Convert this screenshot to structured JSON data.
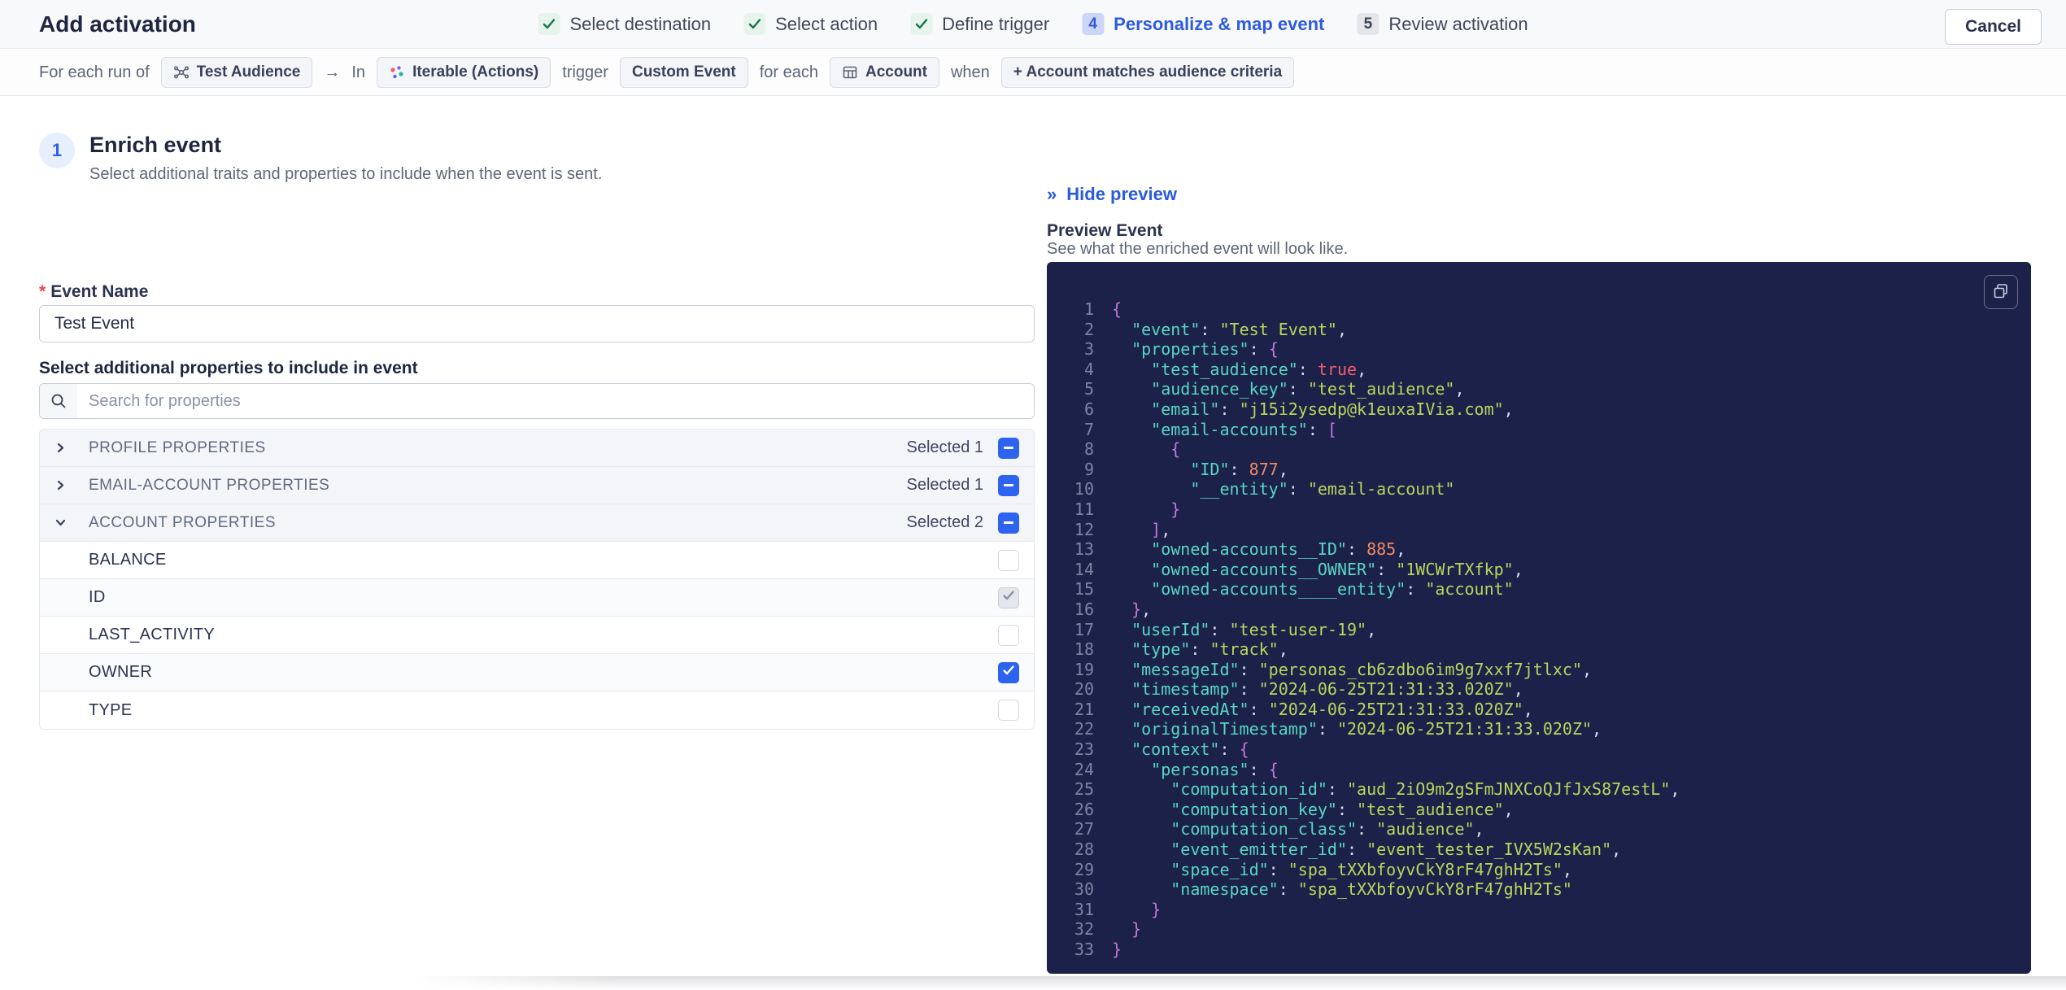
{
  "header": {
    "title": "Add activation",
    "cancel_label": "Cancel",
    "steps": [
      {
        "label": "Select destination",
        "state": "done"
      },
      {
        "label": "Select action",
        "state": "done"
      },
      {
        "label": "Define trigger",
        "state": "done"
      },
      {
        "label": "Personalize & map event",
        "state": "active",
        "number": "4"
      },
      {
        "label": "Review activation",
        "state": "upcoming",
        "number": "5"
      }
    ]
  },
  "trigger_bar": {
    "prefix": "For each run of",
    "audience_chip": "Test Audience",
    "arrow": "→",
    "in_label": "In",
    "destination_chip": "Iterable (Actions)",
    "trigger_label": "trigger",
    "event_chip": "Custom Event",
    "for_each_label": "for each",
    "entity_chip": "Account",
    "when_label": "when",
    "criteria_chip": "+ Account matches audience criteria"
  },
  "enrich": {
    "step_number": "1",
    "title": "Enrich event",
    "subtitle": "Select additional traits and properties to include when the event is sent.",
    "event_name_label": "Event Name",
    "required_marker": "*",
    "event_name_value": "Test Event",
    "properties_label": "Select additional properties to include in event",
    "search_placeholder": "Search for properties",
    "sections": [
      {
        "label": "PROFILE PROPERTIES",
        "selected_text": "Selected 1",
        "expanded": false,
        "items": []
      },
      {
        "label": "EMAIL-ACCOUNT PROPERTIES",
        "selected_text": "Selected 1",
        "expanded": false,
        "items": []
      },
      {
        "label": "ACCOUNT PROPERTIES",
        "selected_text": "Selected 2",
        "expanded": true,
        "items": [
          {
            "label": "BALANCE",
            "checked": false,
            "disabled": false
          },
          {
            "label": "ID",
            "checked": true,
            "disabled": true
          },
          {
            "label": "LAST_ACTIVITY",
            "checked": false,
            "disabled": false
          },
          {
            "label": "OWNER",
            "checked": true,
            "disabled": false
          },
          {
            "label": "TYPE",
            "checked": false,
            "disabled": false
          }
        ]
      }
    ]
  },
  "preview": {
    "hide_glyph": "»",
    "hide_label": "Hide preview",
    "title": "Preview Event",
    "subtitle": "See what the enriched event will look like.",
    "code_lines": [
      {
        "n": "1",
        "tokens": [
          [
            "p",
            "{"
          ]
        ]
      },
      {
        "n": "2",
        "tokens": [
          [
            "d",
            "  "
          ],
          [
            "k",
            "\"event\""
          ],
          [
            "d",
            ": "
          ],
          [
            "s",
            "\"Test Event\""
          ],
          [
            "d",
            ","
          ]
        ]
      },
      {
        "n": "3",
        "tokens": [
          [
            "d",
            "  "
          ],
          [
            "k",
            "\"properties\""
          ],
          [
            "d",
            ": "
          ],
          [
            "p",
            "{"
          ]
        ]
      },
      {
        "n": "4",
        "tokens": [
          [
            "d",
            "    "
          ],
          [
            "k",
            "\"test_audience\""
          ],
          [
            "d",
            ": "
          ],
          [
            "b",
            "true"
          ],
          [
            "d",
            ","
          ]
        ]
      },
      {
        "n": "5",
        "tokens": [
          [
            "d",
            "    "
          ],
          [
            "k",
            "\"audience_key\""
          ],
          [
            "d",
            ": "
          ],
          [
            "s",
            "\"test_audience\""
          ],
          [
            "d",
            ","
          ]
        ]
      },
      {
        "n": "6",
        "tokens": [
          [
            "d",
            "    "
          ],
          [
            "k",
            "\"email\""
          ],
          [
            "d",
            ": "
          ],
          [
            "s",
            "\"j15i2ysedp@k1euxaIVia.com\""
          ],
          [
            "d",
            ","
          ]
        ]
      },
      {
        "n": "7",
        "tokens": [
          [
            "d",
            "    "
          ],
          [
            "k",
            "\"email-accounts\""
          ],
          [
            "d",
            ": "
          ],
          [
            "p",
            "["
          ]
        ]
      },
      {
        "n": "8",
        "tokens": [
          [
            "d",
            "      "
          ],
          [
            "p",
            "{"
          ]
        ]
      },
      {
        "n": "9",
        "tokens": [
          [
            "d",
            "        "
          ],
          [
            "k",
            "\"ID\""
          ],
          [
            "d",
            ": "
          ],
          [
            "n",
            "877"
          ],
          [
            "d",
            ","
          ]
        ]
      },
      {
        "n": "10",
        "tokens": [
          [
            "d",
            "        "
          ],
          [
            "k",
            "\"__entity\""
          ],
          [
            "d",
            ": "
          ],
          [
            "s",
            "\"email-account\""
          ]
        ]
      },
      {
        "n": "11",
        "tokens": [
          [
            "d",
            "      "
          ],
          [
            "p",
            "}"
          ]
        ]
      },
      {
        "n": "12",
        "tokens": [
          [
            "d",
            "    "
          ],
          [
            "p",
            "]"
          ],
          [
            "d",
            ","
          ]
        ]
      },
      {
        "n": "13",
        "tokens": [
          [
            "d",
            "    "
          ],
          [
            "k",
            "\"owned-accounts__ID\""
          ],
          [
            "d",
            ": "
          ],
          [
            "n",
            "885"
          ],
          [
            "d",
            ","
          ]
        ]
      },
      {
        "n": "14",
        "tokens": [
          [
            "d",
            "    "
          ],
          [
            "k",
            "\"owned-accounts__OWNER\""
          ],
          [
            "d",
            ": "
          ],
          [
            "s",
            "\"1WCWrTXfkp\""
          ],
          [
            "d",
            ","
          ]
        ]
      },
      {
        "n": "15",
        "tokens": [
          [
            "d",
            "    "
          ],
          [
            "k",
            "\"owned-accounts____entity\""
          ],
          [
            "d",
            ": "
          ],
          [
            "s",
            "\"account\""
          ]
        ]
      },
      {
        "n": "16",
        "tokens": [
          [
            "d",
            "  "
          ],
          [
            "p",
            "}"
          ],
          [
            "d",
            ","
          ]
        ]
      },
      {
        "n": "17",
        "tokens": [
          [
            "d",
            "  "
          ],
          [
            "k",
            "\"userId\""
          ],
          [
            "d",
            ": "
          ],
          [
            "s",
            "\"test-user-19\""
          ],
          [
            "d",
            ","
          ]
        ]
      },
      {
        "n": "18",
        "tokens": [
          [
            "d",
            "  "
          ],
          [
            "k",
            "\"type\""
          ],
          [
            "d",
            ": "
          ],
          [
            "s",
            "\"track\""
          ],
          [
            "d",
            ","
          ]
        ]
      },
      {
        "n": "19",
        "tokens": [
          [
            "d",
            "  "
          ],
          [
            "k",
            "\"messageId\""
          ],
          [
            "d",
            ": "
          ],
          [
            "s",
            "\"personas_cb6zdbo6im9g7xxf7jtlxc\""
          ],
          [
            "d",
            ","
          ]
        ]
      },
      {
        "n": "20",
        "tokens": [
          [
            "d",
            "  "
          ],
          [
            "k",
            "\"timestamp\""
          ],
          [
            "d",
            ": "
          ],
          [
            "s",
            "\"2024-06-25T21:31:33.020Z\""
          ],
          [
            "d",
            ","
          ]
        ]
      },
      {
        "n": "21",
        "tokens": [
          [
            "d",
            "  "
          ],
          [
            "k",
            "\"receivedAt\""
          ],
          [
            "d",
            ": "
          ],
          [
            "s",
            "\"2024-06-25T21:31:33.020Z\""
          ],
          [
            "d",
            ","
          ]
        ]
      },
      {
        "n": "22",
        "tokens": [
          [
            "d",
            "  "
          ],
          [
            "k",
            "\"originalTimestamp\""
          ],
          [
            "d",
            ": "
          ],
          [
            "s",
            "\"2024-06-25T21:31:33.020Z\""
          ],
          [
            "d",
            ","
          ]
        ]
      },
      {
        "n": "23",
        "tokens": [
          [
            "d",
            "  "
          ],
          [
            "k",
            "\"context\""
          ],
          [
            "d",
            ": "
          ],
          [
            "p",
            "{"
          ]
        ]
      },
      {
        "n": "24",
        "tokens": [
          [
            "d",
            "    "
          ],
          [
            "k",
            "\"personas\""
          ],
          [
            "d",
            ": "
          ],
          [
            "p",
            "{"
          ]
        ]
      },
      {
        "n": "25",
        "tokens": [
          [
            "d",
            "      "
          ],
          [
            "k",
            "\"computation_id\""
          ],
          [
            "d",
            ": "
          ],
          [
            "s",
            "\"aud_2iO9m2gSFmJNXCoQJfJxS87estL\""
          ],
          [
            "d",
            ","
          ]
        ]
      },
      {
        "n": "26",
        "tokens": [
          [
            "d",
            "      "
          ],
          [
            "k",
            "\"computation_key\""
          ],
          [
            "d",
            ": "
          ],
          [
            "s",
            "\"test_audience\""
          ],
          [
            "d",
            ","
          ]
        ]
      },
      {
        "n": "27",
        "tokens": [
          [
            "d",
            "      "
          ],
          [
            "k",
            "\"computation_class\""
          ],
          [
            "d",
            ": "
          ],
          [
            "s",
            "\"audience\""
          ],
          [
            "d",
            ","
          ]
        ]
      },
      {
        "n": "28",
        "tokens": [
          [
            "d",
            "      "
          ],
          [
            "k",
            "\"event_emitter_id\""
          ],
          [
            "d",
            ": "
          ],
          [
            "s",
            "\"event_tester_IVX5W2sKan\""
          ],
          [
            "d",
            ","
          ]
        ]
      },
      {
        "n": "29",
        "tokens": [
          [
            "d",
            "      "
          ],
          [
            "k",
            "\"space_id\""
          ],
          [
            "d",
            ": "
          ],
          [
            "s",
            "\"spa_tXXbfoyvCkY8rF47ghH2Ts\""
          ],
          [
            "d",
            ","
          ]
        ]
      },
      {
        "n": "30",
        "tokens": [
          [
            "d",
            "      "
          ],
          [
            "k",
            "\"namespace\""
          ],
          [
            "d",
            ": "
          ],
          [
            "s",
            "\"spa_tXXbfoyvCkY8rF47ghH2Ts\""
          ]
        ]
      },
      {
        "n": "31",
        "tokens": [
          [
            "d",
            "    "
          ],
          [
            "p",
            "}"
          ]
        ]
      },
      {
        "n": "32",
        "tokens": [
          [
            "d",
            "  "
          ],
          [
            "p",
            "}"
          ]
        ]
      },
      {
        "n": "33",
        "tokens": [
          [
            "p",
            "}"
          ]
        ]
      }
    ]
  },
  "colors": {
    "accent_blue": "#2d5fe8",
    "checkbox_blue": "#2e63f0",
    "done_green": "#17734f",
    "code_bg": "#1c214a",
    "code_key": "#58d6c5",
    "code_string": "#b9d65c",
    "code_number": "#ee8a63",
    "code_bool": "#f25d6d",
    "code_brace": "#c279d6",
    "required_red": "#e5484d"
  }
}
